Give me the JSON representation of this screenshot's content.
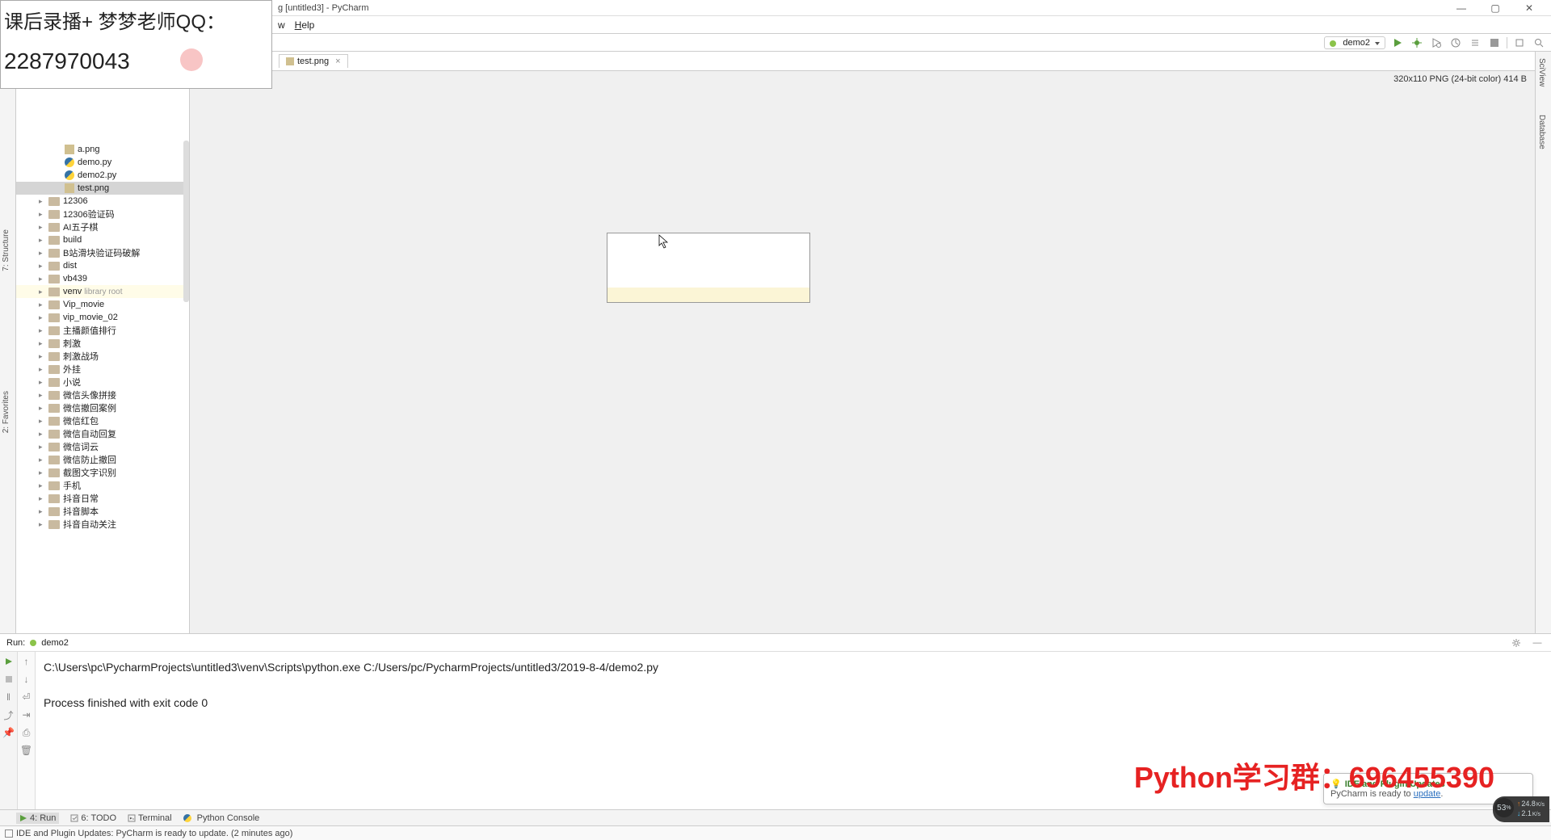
{
  "window": {
    "title_suffix": "g [untitled3] - PyCharm"
  },
  "menu": {
    "w": "w",
    "help": "Help"
  },
  "overlay": {
    "line1": "课后录播+ 梦梦老师QQ：",
    "line2": "2287970043"
  },
  "run_config": {
    "name": "demo2"
  },
  "tree": {
    "files_top": [
      {
        "name": "a.png",
        "type": "img"
      },
      {
        "name": "demo.py",
        "type": "py"
      },
      {
        "name": "demo2.py",
        "type": "py"
      },
      {
        "name": "test.png",
        "type": "img",
        "selected": true
      }
    ],
    "folders": [
      {
        "name": "12306"
      },
      {
        "name": "12306验证码"
      },
      {
        "name": "AI五子棋"
      },
      {
        "name": "build"
      },
      {
        "name": "B站滑块验证码破解"
      },
      {
        "name": "dist"
      },
      {
        "name": "vb439"
      },
      {
        "name": "venv",
        "suffix": "library root",
        "venv": true
      },
      {
        "name": "Vip_movie"
      },
      {
        "name": "vip_movie_02"
      },
      {
        "name": "主播颜值排行"
      },
      {
        "name": "刺激"
      },
      {
        "name": "刺激战场"
      },
      {
        "name": "外挂"
      },
      {
        "name": "小说"
      },
      {
        "name": "微信头像拼接"
      },
      {
        "name": "微信撤回案例"
      },
      {
        "name": "微信红包"
      },
      {
        "name": "微信自动回复"
      },
      {
        "name": "微信词云"
      },
      {
        "name": "微信防止撤回"
      },
      {
        "name": "截图文字识别"
      },
      {
        "name": "手机"
      },
      {
        "name": "抖音日常"
      },
      {
        "name": "抖音脚本"
      },
      {
        "name": "抖音自动关注"
      }
    ]
  },
  "tab": {
    "name": "test.png"
  },
  "image_info": "320x110 PNG (24-bit color) 414 B",
  "run_panel": {
    "label": "Run:",
    "config": "demo2",
    "line1": "C:\\Users\\pc\\PycharmProjects\\untitled3\\venv\\Scripts\\python.exe C:/Users/pc/PycharmProjects/untitled3/2019-8-4/demo2.py",
    "line2": "Process finished with exit code 0"
  },
  "bottom_tabs": {
    "run": "4: Run",
    "todo": "6: TODO",
    "terminal": "Terminal",
    "pyconsole": "Python Console"
  },
  "left_tabs": {
    "structure": "7: Structure",
    "favorites": "2: Favorites"
  },
  "right_tabs": {
    "sciview": "SciView",
    "database": "Database"
  },
  "status": "IDE and Plugin Updates: PyCharm is ready to update. (2 minutes ago)",
  "watermark": "Python学习群：696455390",
  "notif": {
    "title": "IDE and Plugin Updates",
    "body_pre": "PyCharm is ready to ",
    "body_link": "update",
    "body_post": "."
  },
  "net": {
    "pct": "53",
    "up": "24.8",
    "up_u": "K/s",
    "down": "2.1",
    "down_u": "K/s"
  }
}
